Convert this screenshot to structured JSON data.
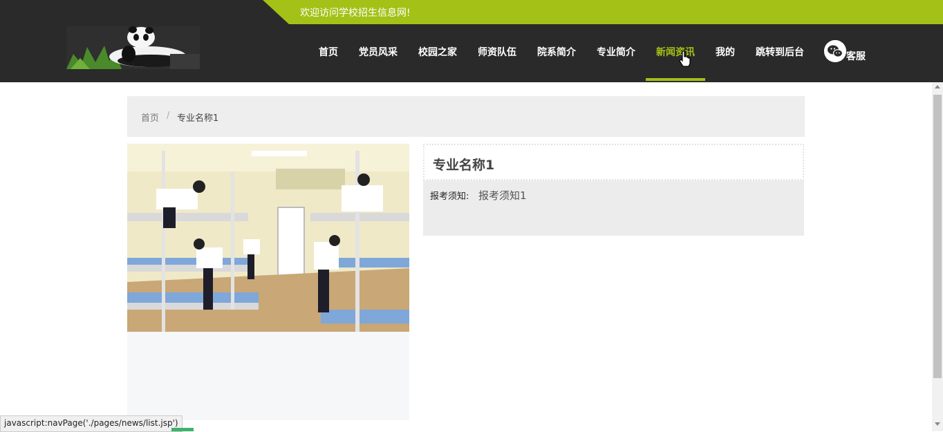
{
  "header": {
    "welcome": "欢迎访问学校招生信息网!",
    "logo_icon": "panda-logo",
    "accent_color": "#a3c116",
    "nav": [
      {
        "label": "首页"
      },
      {
        "label": "党员风采"
      },
      {
        "label": "校园之家"
      },
      {
        "label": "师资队伍"
      },
      {
        "label": "院系简介"
      },
      {
        "label": "专业简介"
      },
      {
        "label": "新闻资讯",
        "active": true
      },
      {
        "label": "我的"
      },
      {
        "label": "跳转到后台"
      }
    ],
    "service_icon": "wechat-icon",
    "service_label": "客服"
  },
  "breadcrumb": {
    "home": "首页",
    "separator": "/",
    "current": "专业名称1"
  },
  "detail": {
    "image_icon": "dormitory-photo",
    "title": "专业名称1",
    "notice_label": "报考须知:",
    "notice_value": "报考须知1"
  },
  "status_bar": {
    "url": "javascript:navPage('./pages/news/list.jsp')"
  }
}
